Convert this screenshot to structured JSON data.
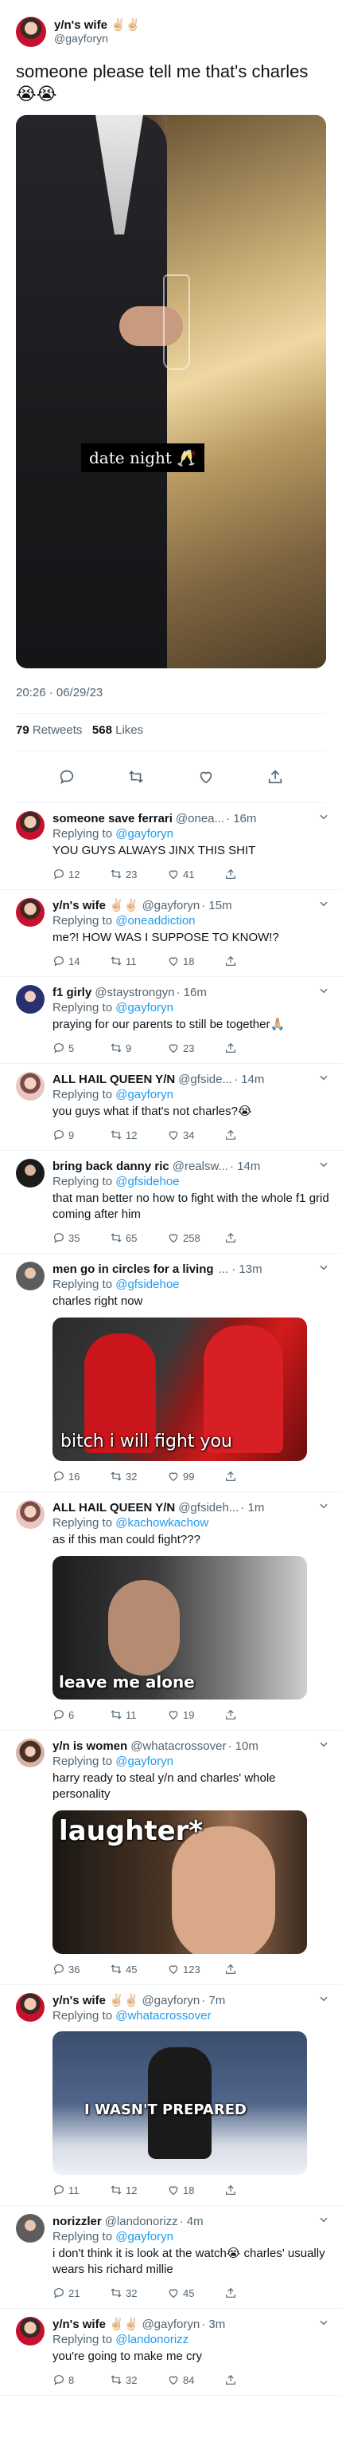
{
  "main": {
    "name": "y/n's wife ✌🏻✌🏻",
    "handle": "@gayforyn",
    "text": "someone please tell me that's charles 😭😭",
    "caption": "date night 🥂",
    "timestamp": "20:26 · 06/29/23",
    "retweets_count": "79",
    "retweets_label": "Retweets",
    "likes_count": "568",
    "likes_label": "Likes"
  },
  "replies": [
    {
      "name": "someone save ferrari",
      "handle": "@onea...",
      "time": "· 16m",
      "replying": "Replying to",
      "to": "@gayforyn",
      "text": "YOU GUYS ALWAYS JINX THIS SHIT",
      "c": "12",
      "r": "23",
      "l": "41"
    },
    {
      "name": "y/n's wife ✌🏻✌🏻",
      "handle": "@gayforyn",
      "time": "· 15m",
      "replying": "Replying to",
      "to": "@oneaddiction",
      "text": "me?! HOW WAS I SUPPOSE TO KNOW!?",
      "c": "14",
      "r": "11",
      "l": "18"
    },
    {
      "name": "f1 girly",
      "handle": "@staystrongyn",
      "time": "· 16m",
      "replying": "Replying to",
      "to": "@gayforyn",
      "text": "praying for our parents to still be together🙏🏼",
      "c": "5",
      "r": "9",
      "l": "23"
    },
    {
      "name": "ALL HAIL QUEEN Y/N",
      "handle": "@gfside...",
      "time": "· 14m",
      "replying": "Replying to",
      "to": "@gayforyn",
      "text": "you guys what if that's not charles?😭",
      "c": "9",
      "r": "12",
      "l": "34"
    },
    {
      "name": "bring back danny ric",
      "handle": "@realsw...",
      "time": "· 14m",
      "replying": "Replying to",
      "to": "@gfsidehoe",
      "text": "that man better no how to fight with the whole f1 grid coming after him",
      "c": "35",
      "r": "65",
      "l": "258"
    },
    {
      "name": "men go in circles for a living",
      "handle": "",
      "time": "... · 13m",
      "replying": "Replying to",
      "to": "@gfsidehoe",
      "text": "charles right now",
      "overlay": "bitch i will fight you",
      "c": "16",
      "r": "32",
      "l": "99"
    },
    {
      "name": "ALL HAIL QUEEN Y/N",
      "handle": "@gfsideh...",
      "time": "· 1m",
      "replying": "Replying to",
      "to": "@kachowkachow",
      "text": "as if this man could fight???",
      "overlay": "leave me alone",
      "c": "6",
      "r": "11",
      "l": "19"
    },
    {
      "name": "y/n is women",
      "handle": "@whatacrossover",
      "time": "· 10m",
      "replying": "Replying to",
      "to": "@gayforyn",
      "text": "harry ready to steal y/n and charles' whole personality",
      "overlay": "laughter*",
      "c": "36",
      "r": "45",
      "l": "123"
    },
    {
      "name": "y/n's wife ✌🏻✌🏻",
      "handle": "@gayforyn",
      "time": "· 7m",
      "replying": "Replying to",
      "to": "@whatacrossover",
      "text": "",
      "overlay": "I WASN'T PREPARED",
      "c": "11",
      "r": "12",
      "l": "18"
    },
    {
      "name": "norizzler",
      "handle": "@landonorizz",
      "time": "· 4m",
      "replying": "Replying to",
      "to": "@gayforyn",
      "text": "i don't think it is look at the watch😭 charles' usually wears his richard millie",
      "c": "21",
      "r": "32",
      "l": "45"
    },
    {
      "name": "y/n's wife ✌🏻✌🏻",
      "handle": "@gayforyn",
      "time": "· 3m",
      "replying": "Replying to",
      "to": "@landonorizz",
      "text": "you're going to make me cry",
      "c": "8",
      "r": "32",
      "l": "84"
    }
  ]
}
